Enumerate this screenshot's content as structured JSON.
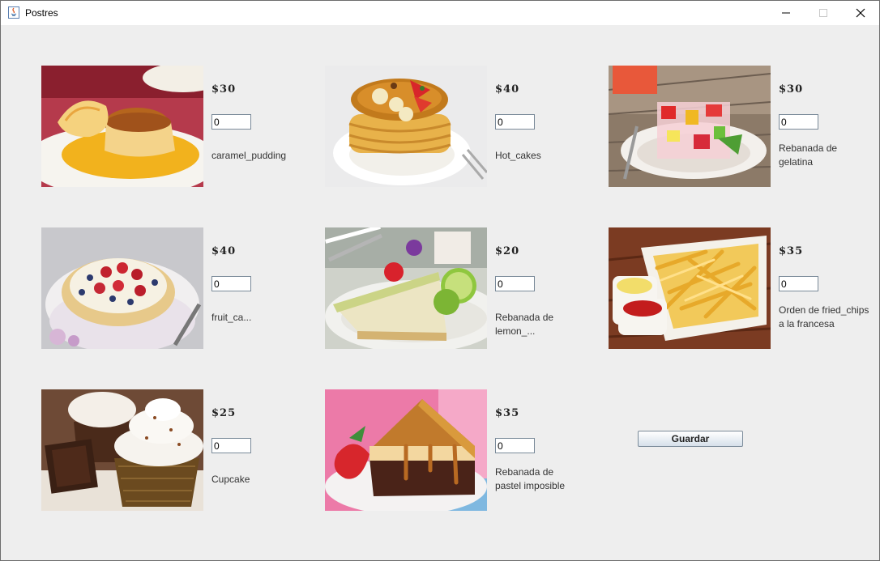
{
  "window": {
    "title": "Postres"
  },
  "titlebar_buttons": {
    "minimize": "minimize-icon",
    "maximize": "maximize-icon",
    "close": "close-icon"
  },
  "desserts": [
    {
      "name": "caramel_pudding",
      "price": "$30",
      "quantity": "0",
      "image": "caramel-pudding-photo"
    },
    {
      "name": "Hot_cakes",
      "price": "$40",
      "quantity": "0",
      "image": "hot-cakes-photo"
    },
    {
      "name": "Rebanada de\ngelatina",
      "price": "$30",
      "quantity": "0",
      "image": "gelatina-photo"
    },
    {
      "name": "fruit_ca...",
      "price": "$40",
      "quantity": "0",
      "image": "fruit-cake-photo"
    },
    {
      "name": "Rebanada de lemon_...",
      "price": "$20",
      "quantity": "0",
      "image": "lemon-pie-photo"
    },
    {
      "name": "Orden de fried_chips\na la francesa",
      "price": "$35",
      "quantity": "0",
      "image": "fries-photo"
    },
    {
      "name": "Cupcake",
      "price": "$25",
      "quantity": "0",
      "image": "cupcake-photo"
    },
    {
      "name": "Rebanada de\npastel imposible",
      "price": "$35",
      "quantity": "0",
      "image": "pastel-imposible-photo"
    }
  ],
  "save_button": {
    "label": "Guardar"
  }
}
